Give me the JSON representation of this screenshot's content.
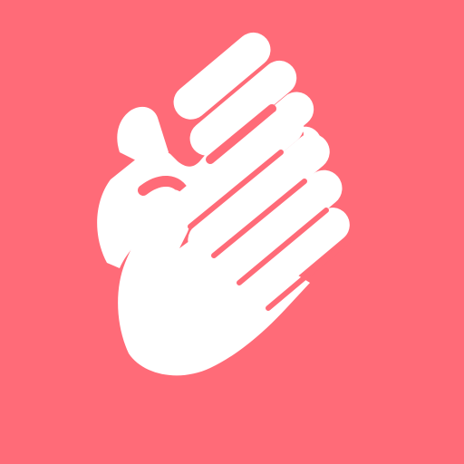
{
  "icon": {
    "name": "clapping-hands-icon",
    "colors": {
      "background": "#FF6B78",
      "hands": "#FFFFFF"
    }
  }
}
